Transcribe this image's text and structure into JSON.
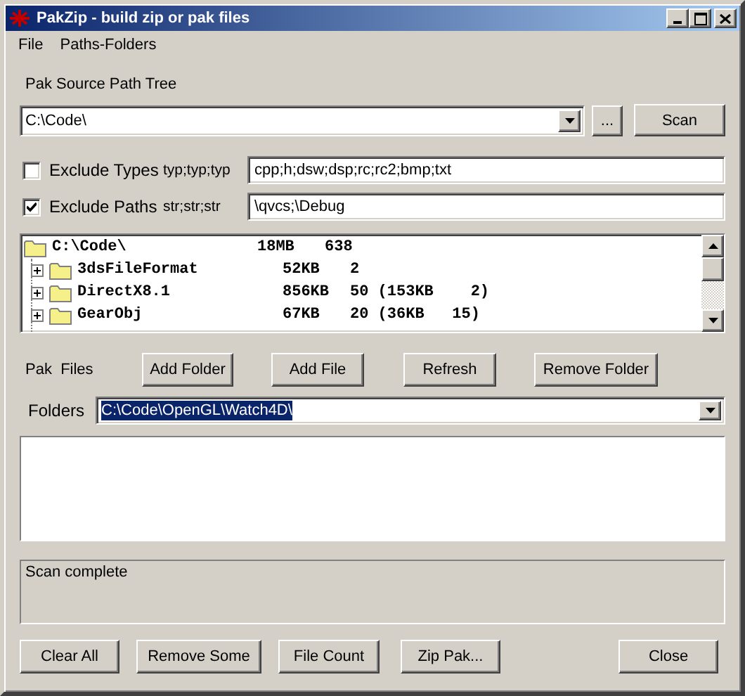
{
  "window": {
    "title": "PakZip - build zip or pak files"
  },
  "menu": [
    {
      "label": "File"
    },
    {
      "label": "Paths-Folders"
    }
  ],
  "source": {
    "label": "Pak Source Path Tree",
    "value": "C:\\Code\\",
    "browse_button": "...",
    "scan_button": "Scan"
  },
  "filters": [
    {
      "label": "Exclude Types",
      "checked": false,
      "hint": "typ;typ;typ",
      "value": "cpp;h;dsw;dsp;rc;rc2;bmp;txt"
    },
    {
      "label": "Exclude Paths",
      "checked": true,
      "hint": "str;str;str",
      "value": "\\qvcs;\\Debug"
    }
  ],
  "tree": {
    "root": {
      "name": "C:\\Code\\",
      "size": "18MB",
      "count": "638",
      "children": [
        {
          "name": "3dsFileFormat",
          "size": "52KB",
          "count": "2",
          "expanded": false
        },
        {
          "name": "DirectX8.1",
          "size": "856KB",
          "count": "50 (153KB    2)",
          "expanded": false
        },
        {
          "name": "GearObj",
          "size": "67KB",
          "count": "20 (36KB   15)",
          "expanded": false
        }
      ]
    }
  },
  "pak_files": {
    "label": "Pak  Files",
    "buttons": [
      "Add Folder",
      "Add File",
      "Refresh",
      "Remove Folder"
    ]
  },
  "folders": {
    "label": "Folders",
    "value": "C:\\Code\\OpenGL\\Watch4D\\",
    "text_selected": true
  },
  "status": {
    "text": "Scan complete"
  },
  "buttons": [
    "Clear All",
    "Remove Some",
    "File Count",
    "Zip Pak...",
    "Close"
  ]
}
